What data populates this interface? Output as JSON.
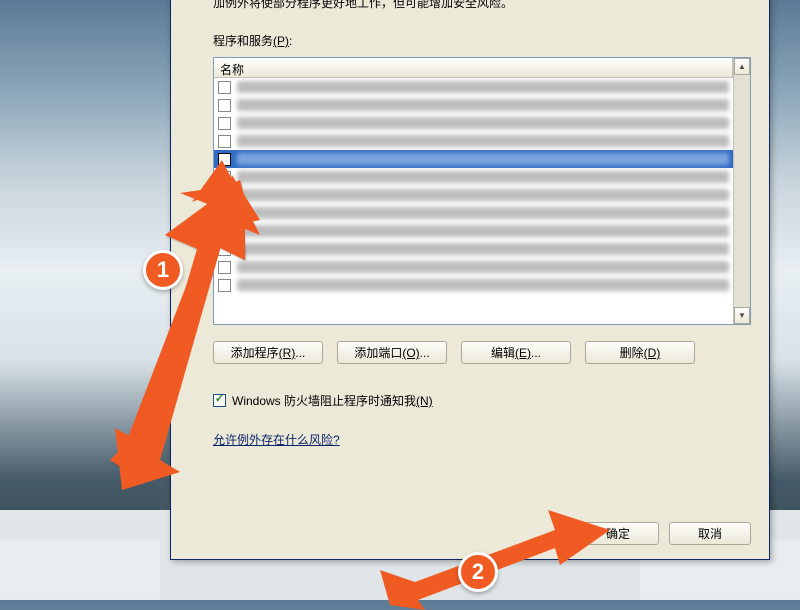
{
  "description": "加例外将使部分程序更好地工作，但可能增加安全风险。",
  "programs_services_label": "程序和服务",
  "programs_services_accesskey": "(P)",
  "list_header": "名称",
  "buttons": {
    "add_program": "添加程序",
    "add_program_key": "(R)",
    "add_port": "添加端口",
    "add_port_key": "(O)",
    "edit": "编辑",
    "edit_key": "(E)",
    "delete": "删除",
    "delete_key": "(D)",
    "ellipsis": "..."
  },
  "notify_label": "Windows 防火墙阻止程序时通知我",
  "notify_key": "(N)",
  "risk_link": "允许例外存在什么风险?",
  "footer": {
    "ok": "确定",
    "cancel": "取消"
  },
  "annotations": {
    "step1": "1",
    "step2": "2"
  },
  "colors": {
    "accent": "#f05a23",
    "selection": "#316ac5",
    "dialog_bg": "#ece9d8"
  }
}
